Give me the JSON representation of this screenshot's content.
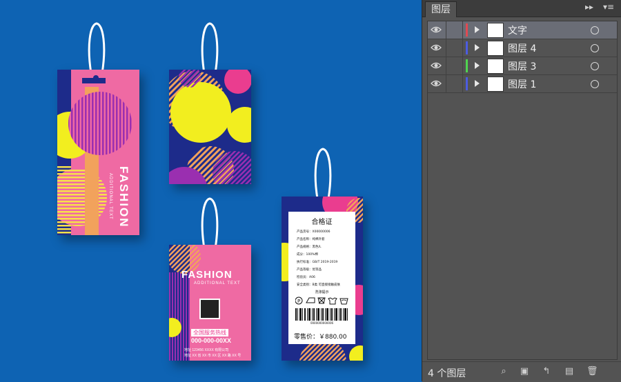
{
  "artwork": {
    "tag1": {
      "brand": "FASHION",
      "sub": "ADDITIONAL TEXT"
    },
    "tag3": {
      "brand": "FASHION",
      "sub": "ADDITIONAL TEXT",
      "hotline_label": "全国服务热线",
      "hotline_number": "000-000-00XX",
      "address_line1": "地址 123456 XXXX 有限公司",
      "address_line2": "地址 XX 省 XX 市 XX 区 XX 路 XX 号"
    },
    "tag4": {
      "title": "合格证",
      "fields": [
        "产品货号：X00000006",
        "产品名称：纯棉外套",
        "产品规格：黑色/L",
        "成分：100%棉",
        "执行标准：GB/T 2019-2019",
        "产品等级：优等品",
        "检验员：A06",
        "安全类别：B类 可直接接触皮肤"
      ],
      "care_title": "洗涤提示",
      "barcode_number": "0000000000006",
      "price": "零售价：￥880.00"
    }
  },
  "layers_panel": {
    "tab_label": "图层",
    "collapse_glyph": "▸▸",
    "menu_glyph": "▾≡",
    "layers": [
      {
        "name": "文字",
        "color": "#e04a52",
        "selected": true
      },
      {
        "name": "图层 4",
        "color": "#4c5ce0",
        "selected": false
      },
      {
        "name": "图层 3",
        "color": "#4fd44f",
        "selected": false
      },
      {
        "name": "图层 1",
        "color": "#4c5ce0",
        "selected": false
      }
    ],
    "status_text": "4 个图层"
  }
}
